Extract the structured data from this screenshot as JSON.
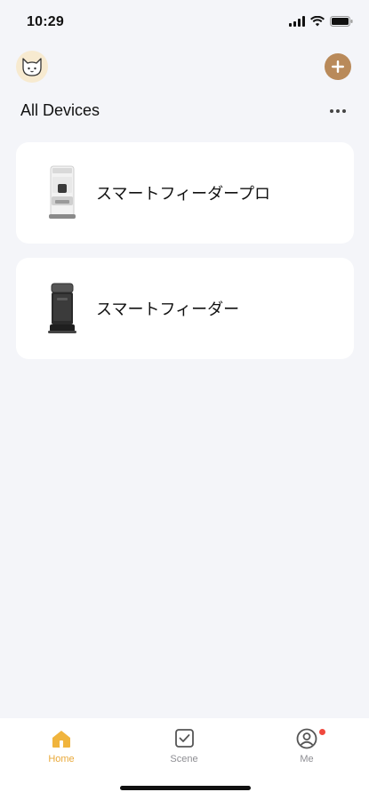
{
  "status_bar": {
    "time": "10:29"
  },
  "header": {
    "avatar_icon": "cat-face-icon",
    "add_icon": "plus-icon",
    "more_icon": "ellipsis-icon"
  },
  "section": {
    "title": "All Devices"
  },
  "devices": [
    {
      "name": "スマートフィーダープロ",
      "icon": "pet-feeder-pro-image"
    },
    {
      "name": "スマートフィーダー",
      "icon": "pet-feeder-image"
    }
  ],
  "tab_bar": {
    "tabs": [
      {
        "label": "Home",
        "icon": "home-icon",
        "active": true
      },
      {
        "label": "Scene",
        "icon": "checkbox-icon",
        "active": false
      },
      {
        "label": "Me",
        "icon": "user-icon",
        "active": false,
        "badge": true
      }
    ]
  },
  "colors": {
    "background": "#f4f5f9",
    "accent": "#e9a93a",
    "add_button": "#b98a5a",
    "badge": "#f0483e"
  }
}
